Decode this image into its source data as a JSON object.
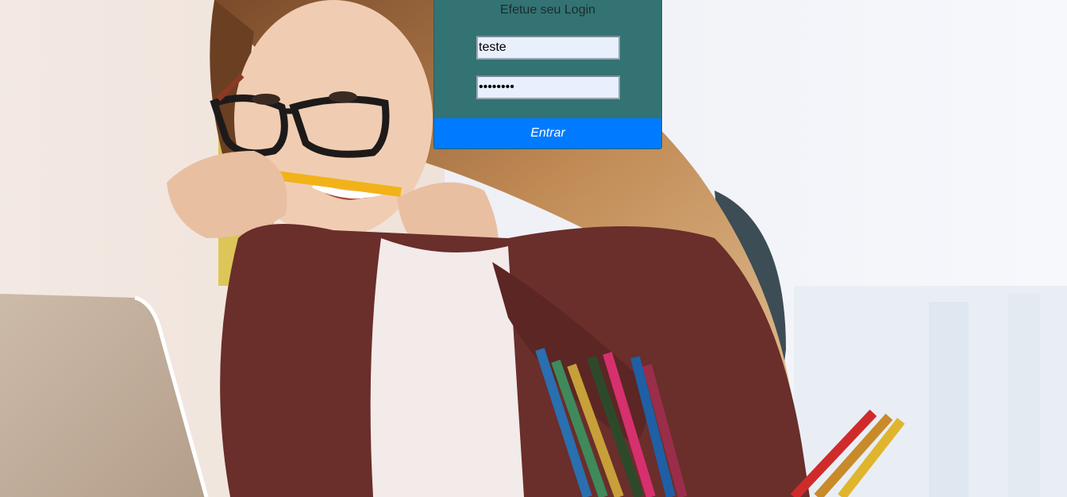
{
  "login": {
    "title": "Efetue seu Login",
    "username_value": "teste",
    "password_value": "12345678",
    "submit_label": "Entrar"
  },
  "colors": {
    "panel_bg": "#337373",
    "button_bg": "#007bff",
    "input_bg": "#e8f0fe"
  }
}
